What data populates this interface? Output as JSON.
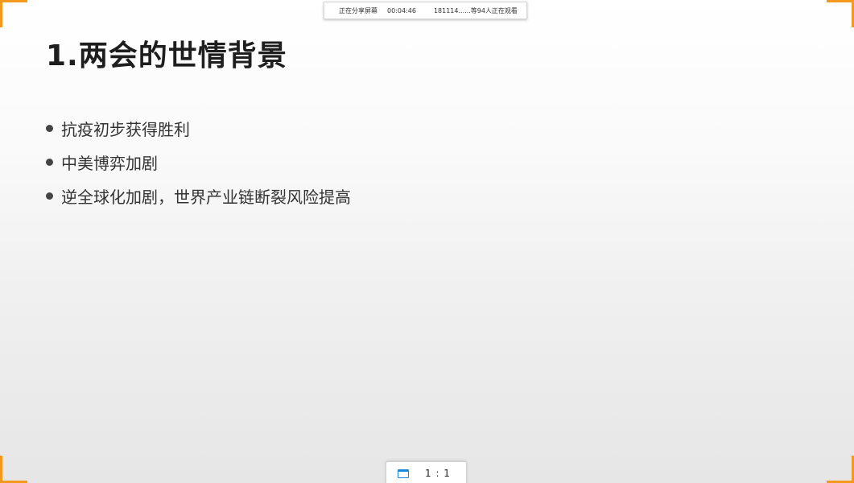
{
  "share_bar": {
    "status": "正在分享屏幕",
    "timer": "00:04:46",
    "viewers": "181114......等94人正在观看"
  },
  "slide": {
    "title": "1.两会的世情背景",
    "bullets": [
      "抗疫初步获得胜利",
      "中美博弈加剧",
      "逆全球化加剧，世界产业链断裂风险提高"
    ]
  },
  "bottom_bar": {
    "icon": "window-icon",
    "zoom_label": "1 : 1"
  },
  "colors": {
    "frame_accent": "#f39a1e",
    "icon_blue": "#1e88d8"
  }
}
